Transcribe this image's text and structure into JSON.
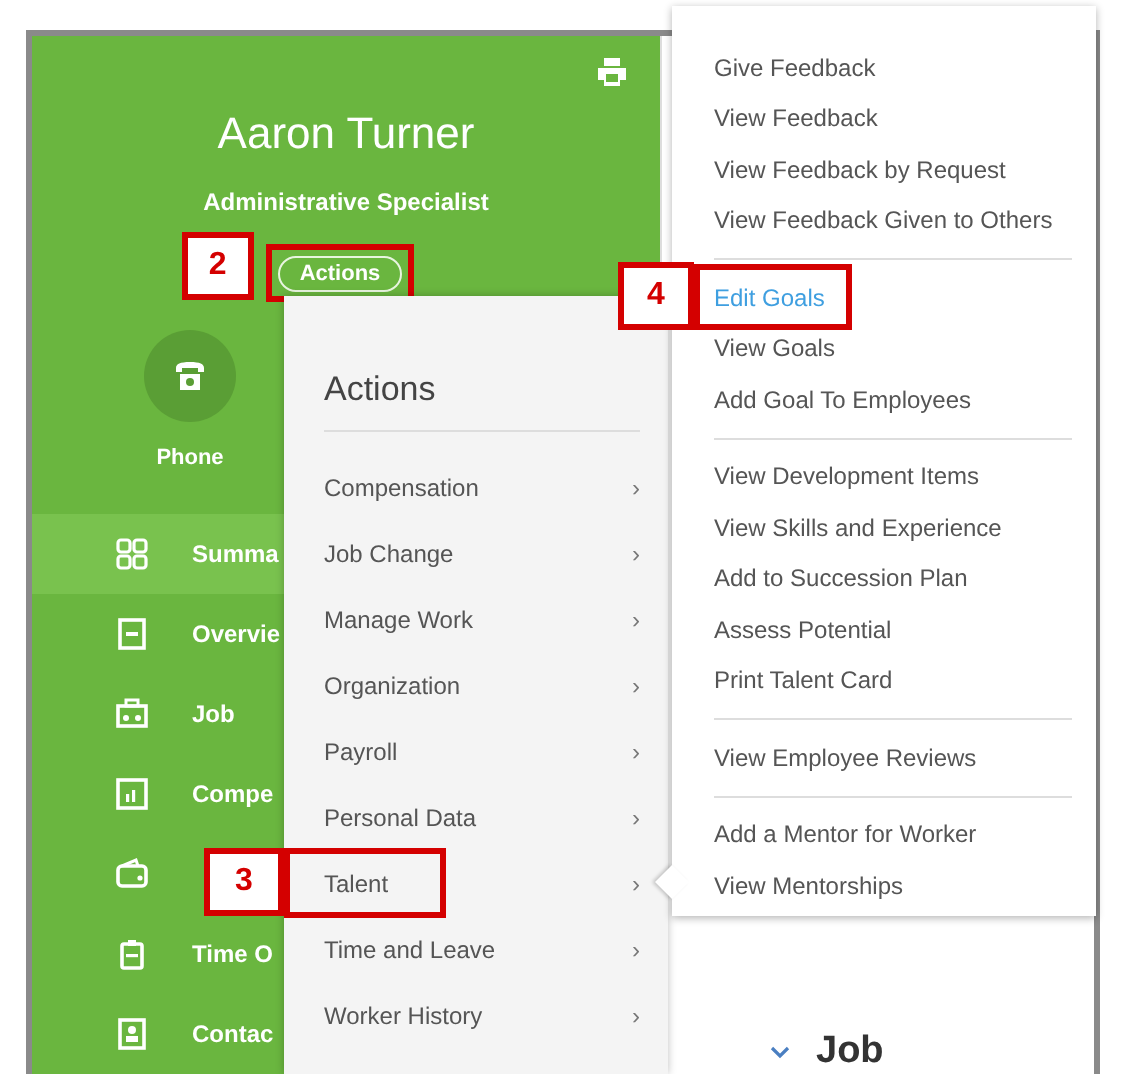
{
  "profile": {
    "name": "Aaron Turner",
    "title": "Administrative Specialist",
    "actions_button": {
      "label": "Actions",
      "callout": "2"
    },
    "contact": {
      "label": "Phone"
    }
  },
  "nav": [
    {
      "label": "Summa",
      "selected": true
    },
    {
      "label": "Overvie",
      "selected": false
    },
    {
      "label": "Job",
      "selected": false
    },
    {
      "label": "Compe",
      "selected": false
    },
    {
      "selected": false
    },
    {
      "label": "Time O",
      "selected": false
    },
    {
      "label": "Contac",
      "selected": false
    }
  ],
  "actions_menu": {
    "title": "Actions",
    "items": [
      {
        "label": "Compensation",
        "chevron": "›"
      },
      {
        "label": "Job Change",
        "chevron": "›"
      },
      {
        "label": "Manage Work",
        "chevron": "›"
      },
      {
        "label": "Organization",
        "chevron": "›"
      },
      {
        "label": "Payroll",
        "chevron": "›"
      },
      {
        "label": "Personal Data",
        "chevron": "›"
      },
      {
        "label": "Talent",
        "chevron": "›",
        "callout": "3"
      },
      {
        "label": "Time and Leave",
        "chevron": "›"
      },
      {
        "label": "Worker History",
        "chevron": "›"
      }
    ]
  },
  "talent_menu": {
    "groups": [
      [
        {
          "label": "Give Feedback",
          "selected": false
        },
        {
          "label": "View Feedback",
          "selected": false
        },
        {
          "label": "View Feedback by Request",
          "selected": false
        },
        {
          "label": "View Feedback Given to Others",
          "selected": false
        }
      ],
      [
        {
          "label": "Edit Goals",
          "selected": true,
          "callout": "4"
        },
        {
          "label": "View Goals",
          "selected": false
        },
        {
          "label": "Add Goal To Employees",
          "selected": false
        }
      ],
      [
        {
          "label": "View Development Items",
          "selected": false
        },
        {
          "label": "View Skills and Experience",
          "selected": false
        },
        {
          "label": "Add to Succession Plan",
          "selected": false
        },
        {
          "label": "Assess Potential",
          "selected": false
        },
        {
          "label": "Print Talent Card",
          "selected": false
        }
      ],
      [
        {
          "label": "View Employee Reviews",
          "selected": false
        }
      ],
      [
        {
          "label": "Add a Mentor for Worker",
          "selected": false
        },
        {
          "label": "View Mentorships",
          "selected": false
        }
      ]
    ]
  },
  "section": {
    "title": "Job",
    "expanded": true
  }
}
